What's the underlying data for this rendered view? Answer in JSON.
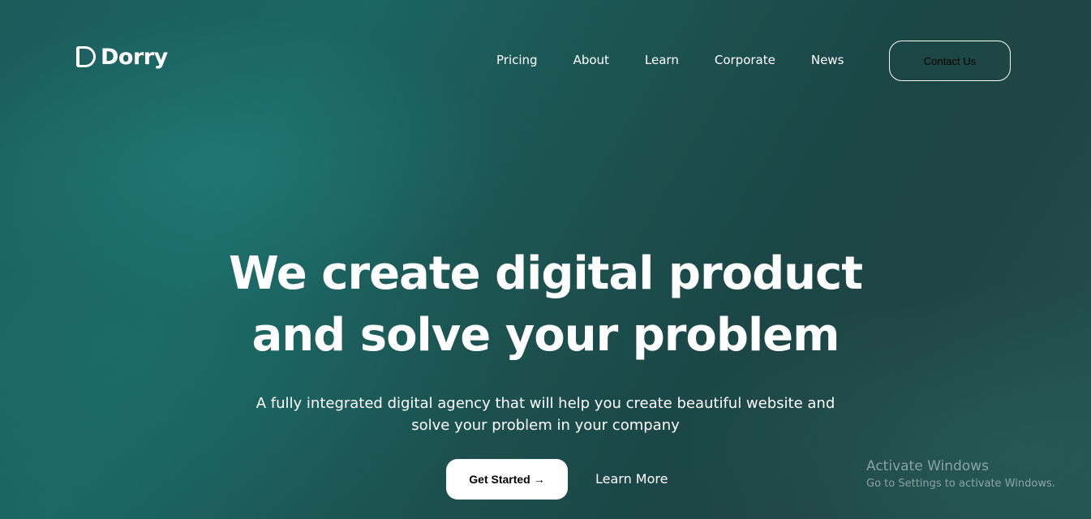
{
  "brand": {
    "name": "Dorry",
    "icon": "d-logo-icon"
  },
  "nav": {
    "items": [
      "Pricing",
      "About",
      "Learn",
      "Corporate",
      "News"
    ],
    "contact_label": "Contact Us"
  },
  "hero": {
    "title_lines": [
      "We create digital product",
      "and solve your problem"
    ],
    "subtitle_lines": [
      "A fully integrated digital agency that will help you create beautiful website and",
      "solve your problem in your company"
    ],
    "primary_cta": "Get Started",
    "primary_cta_arrow": "→",
    "secondary_cta": "Learn More"
  },
  "watermark": {
    "title": "Activate Windows",
    "subtitle": "Go to Settings to activate Windows."
  },
  "colors": {
    "background_start": "#1b6664",
    "background_end": "#1f4544",
    "text": "#ffffff",
    "button_bg": "#ffffff",
    "button_text": "#000000"
  }
}
